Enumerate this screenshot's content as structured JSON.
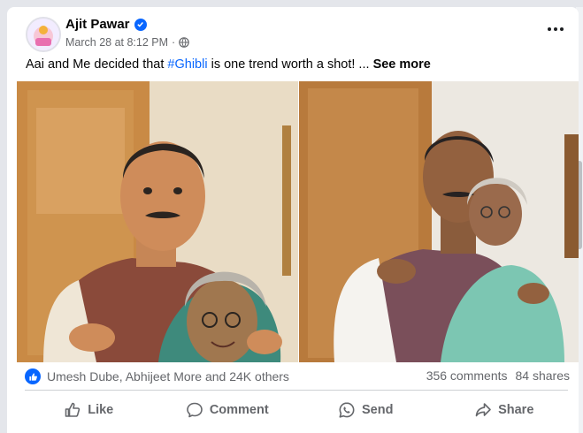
{
  "post": {
    "author": "Ajit Pawar",
    "timestamp": "March 28 at 8:12 PM",
    "separator": "·",
    "text_before": "Aai and Me decided that ",
    "hashtag": "#Ghibli",
    "text_after": " is one trend worth a shot! ... ",
    "see_more": "See more"
  },
  "engagement": {
    "reactions": "Umesh Dube, Abhijeet More and 24K others",
    "comments": "356 comments",
    "shares": "84 shares"
  },
  "actions": {
    "like": "Like",
    "comment": "Comment",
    "send": "Send",
    "share": "Share"
  },
  "icons": {
    "verified": "verified-badge-icon",
    "privacy": "globe-icon",
    "more": "more-options-icon",
    "like": "thumbs-up-icon",
    "comment": "speech-bubble-icon",
    "send": "whatsapp-icon",
    "share": "share-arrow-icon"
  },
  "colors": {
    "brand": "#0866ff",
    "secondary_text": "#65676b",
    "primary_text": "#050505"
  }
}
